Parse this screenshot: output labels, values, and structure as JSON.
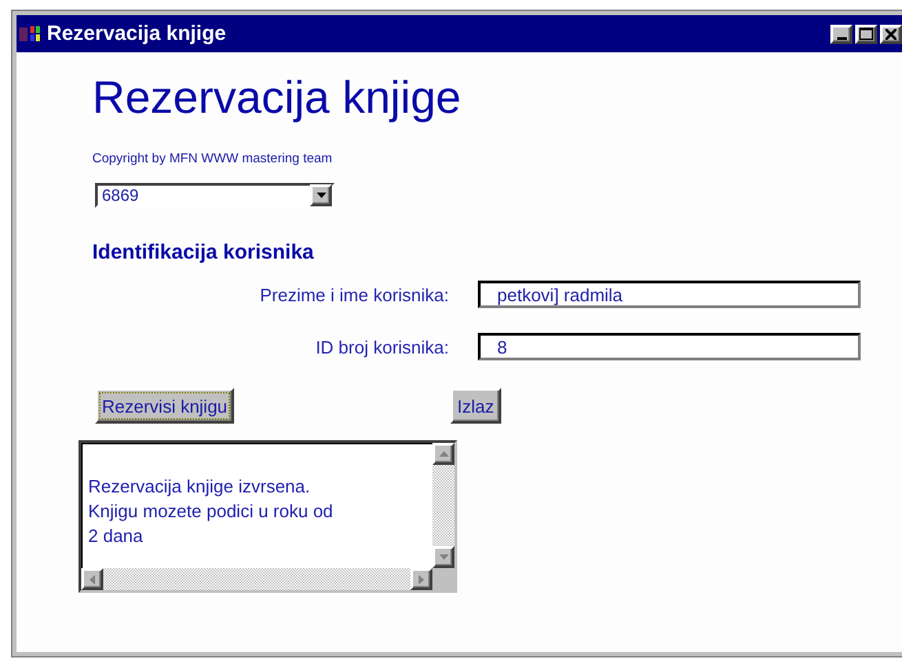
{
  "window": {
    "title": "Rezervacija knjige"
  },
  "heading": "Rezervacija knjige",
  "copyright": "Copyright by MFN WWW mastering team",
  "book_select": {
    "value": "6869"
  },
  "section_title": "Identifikacija korisnika",
  "fields": [
    {
      "label": "Prezime i ime korisnika:",
      "value": "petkovi] radmila"
    },
    {
      "label": "ID broj korisnika:",
      "value": "8"
    }
  ],
  "buttons": [
    {
      "label": "Rezervisi knjigu",
      "focused": true
    },
    {
      "label": "Izlaz",
      "focused": false
    }
  ],
  "message": "Rezervacija knjige izvrsena.\nKnjigu mozete podici u roku od\n2 dana"
}
